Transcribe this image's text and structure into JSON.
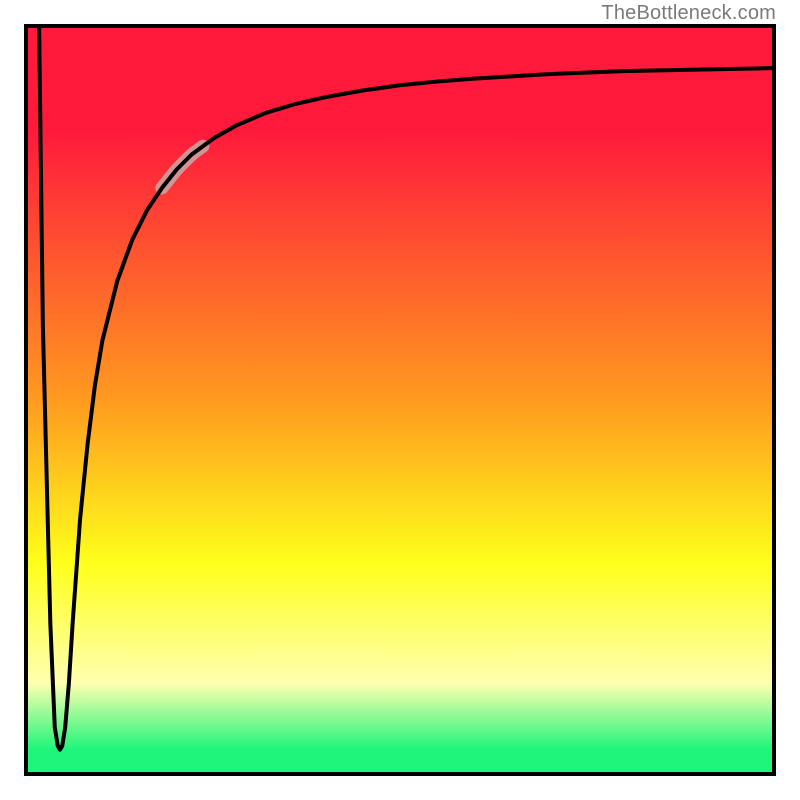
{
  "watermark": "TheBottleneck.com",
  "colors": {
    "red": "#ff1a3c",
    "orange": "#ff9a1f",
    "yellow": "#feff1a",
    "pale_yellow": "#ffffb0",
    "green": "#1ef57a",
    "stroke": "#000000",
    "highlight": "#cda0a0"
  },
  "chart_data": {
    "type": "line",
    "title": "",
    "xlabel": "",
    "ylabel": "",
    "xlim": [
      0,
      100
    ],
    "ylim": [
      0,
      100
    ],
    "series": [
      {
        "name": "bottleneck-curve",
        "x": [
          1.5,
          2.0,
          3.0,
          3.6,
          4.0,
          4.3,
          4.6,
          5.0,
          5.5,
          6.0,
          7.0,
          8.0,
          9.0,
          10.0,
          12.0,
          14.0,
          16.0,
          18.0,
          20.0,
          22.0,
          25.0,
          28.0,
          32.0,
          36.0,
          40.0,
          45.0,
          50.0,
          55.0,
          60.0,
          65.0,
          70.0,
          75.0,
          80.0,
          85.0,
          90.0,
          95.0,
          100.0
        ],
        "y": [
          100.0,
          60.0,
          20.0,
          6.0,
          3.5,
          3.0,
          3.5,
          6.0,
          12.0,
          20.0,
          34.0,
          44.0,
          52.0,
          58.0,
          66.0,
          71.5,
          75.5,
          78.5,
          81.0,
          83.0,
          85.2,
          86.9,
          88.6,
          89.8,
          90.7,
          91.6,
          92.3,
          92.8,
          93.2,
          93.5,
          93.8,
          94.0,
          94.2,
          94.3,
          94.4,
          94.5,
          94.6
        ]
      }
    ],
    "annotations": [
      {
        "name": "highlight-segment",
        "x_range": [
          18.0,
          23.5
        ],
        "y_range": [
          78.5,
          84.0
        ]
      }
    ],
    "gradient_bands": [
      {
        "y_from": 100,
        "y_to": 86,
        "color_from": "red",
        "color_to": "red"
      },
      {
        "y_from": 86,
        "y_to": 50,
        "color_from": "red",
        "color_to": "orange"
      },
      {
        "y_from": 50,
        "y_to": 28,
        "color_from": "orange",
        "color_to": "yellow"
      },
      {
        "y_from": 28,
        "y_to": 12,
        "color_from": "yellow",
        "color_to": "pale_yellow"
      },
      {
        "y_from": 12,
        "y_to": 3,
        "color_from": "pale_yellow",
        "color_to": "green"
      },
      {
        "y_from": 3,
        "y_to": 0,
        "color_from": "green",
        "color_to": "green"
      }
    ]
  }
}
